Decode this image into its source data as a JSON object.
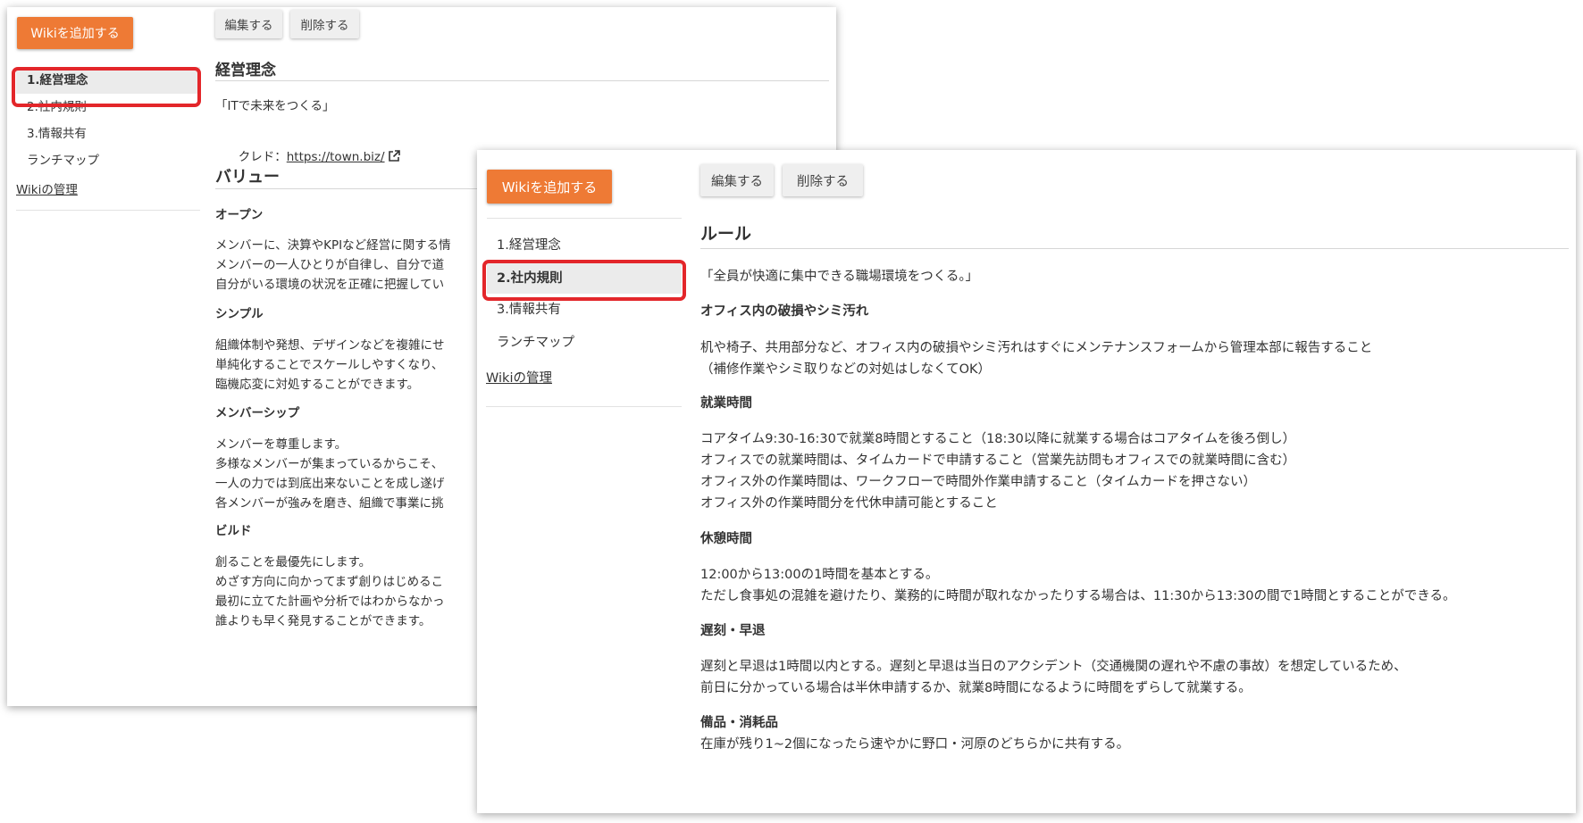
{
  "back_window": {
    "add_button": "Wikiを追加する",
    "sidebar": {
      "items": [
        "1.経営理念",
        "2.社内規則",
        "3.情報共有",
        "ランチマップ"
      ],
      "manage_link": "Wikiの管理"
    },
    "toolbar": {
      "edit": "編集する",
      "delete": "削除する"
    },
    "page_title": "経営理念",
    "motto": "「ITで未来をつくる」",
    "credit_label": "クレド：",
    "credit_url": "https://town.biz/",
    "values_heading": "バリュー",
    "sections": [
      {
        "heading": "オープン",
        "lines": [
          "メンバーに、決算やKPIなど経営に関する情",
          "メンバーの一人ひとりが自律し、自分で道",
          "自分がいる環境の状況を正確に把握してい"
        ]
      },
      {
        "heading": "シンプル",
        "lines": [
          "組織体制や発想、デザインなどを複雑にせ",
          "単純化することでスケールしやすくなり、",
          "臨機応変に対処することができます。"
        ]
      },
      {
        "heading": "メンバーシップ",
        "lines": [
          "メンバーを尊重します。",
          "多様なメンバーが集まっているからこそ、",
          "一人の力では到底出来ないことを成し遂げ",
          "各メンバーが強みを磨き、組織で事業に挑"
        ]
      },
      {
        "heading": "ビルド",
        "lines": [
          "創ることを最優先にします。",
          "めざす方向に向かってまず創りはじめるこ",
          "最初に立てた計画や分析ではわからなかっ",
          "誰よりも早く発見することができます。"
        ]
      }
    ]
  },
  "front_window": {
    "add_button": "Wikiを追加する",
    "sidebar": {
      "items": [
        "1.経営理念",
        "2.社内規則",
        "3.情報共有",
        "ランチマップ"
      ],
      "manage_link": "Wikiの管理"
    },
    "toolbar": {
      "edit": "編集する",
      "delete": "削除する"
    },
    "page_title": "ルール",
    "intro": "「全員が快適に集中できる職場環境をつくる。」",
    "sections": [
      {
        "heading": "オフィス内の破損やシミ汚れ",
        "lines": [
          "机や椅子、共用部分など、オフィス内の破損やシミ汚れはすぐにメンテナンスフォームから管理本部に報告すること",
          "（補修作業やシミ取りなどの対処はしなくてOK）"
        ]
      },
      {
        "heading": "就業時間",
        "lines": [
          "コアタイム9:30-16:30で就業8時間とすること（18:30以降に就業する場合はコアタイムを後ろ倒し）",
          "オフィスでの就業時間は、タイムカードで申請すること（営業先訪問もオフィスでの就業時間に含む）",
          "オフィス外の作業時間は、ワークフローで時間外作業申請すること（タイムカードを押さない）",
          "オフィス外の作業時間分を代休申請可能とすること"
        ]
      },
      {
        "heading": "休憩時間",
        "lines": [
          "12:00から13:00の1時間を基本とする。",
          "ただし食事処の混雑を避けたり、業務的に時間が取れなかったりする場合は、11:30から13:30の間で1時間とすることができる。"
        ]
      },
      {
        "heading": "遅刻・早退",
        "lines": [
          "遅刻と早退は1時間以内とする。遅刻と早退は当日のアクシデント（交通機関の遅れや不慮の事故）を想定しているため、",
          "前日に分かっている場合は半休申請するか、就業8時間になるように時間をずらして就業する。"
        ]
      },
      {
        "heading": "備品・消耗品",
        "lines": [
          "在庫が残り1~2個になったら速やかに野口・河原のどちらかに共有する。"
        ]
      }
    ]
  },
  "colors": {
    "accent": "#ee7a35",
    "highlight": "#e3262a",
    "selected_bg": "#ebebeb"
  },
  "icons": [
    "external-link-icon"
  ]
}
